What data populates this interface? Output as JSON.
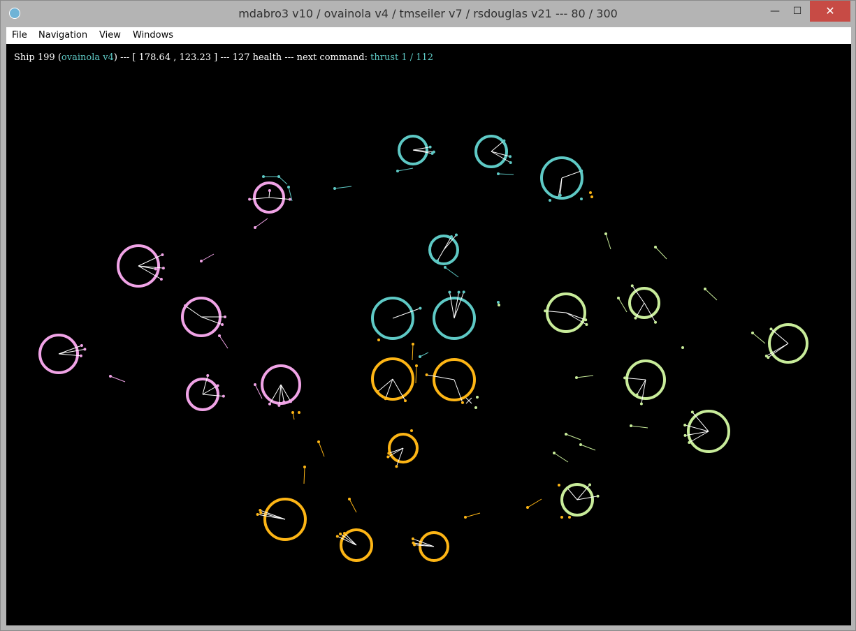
{
  "window": {
    "title": "mdabro3 v10 / ovainola v4 / tmseiler v7 / rsdouglas v21 --- 80 / 300",
    "icon": "gear-icon",
    "controls": {
      "minimize": "—",
      "maximize": "☐",
      "close": "✕"
    }
  },
  "menu": {
    "items": [
      "File",
      "Navigation",
      "View",
      "Windows"
    ]
  },
  "status": {
    "ship_label": "Ship 199",
    "player": "ovainola v4",
    "coords": "[ 178.64 , 123.23 ]",
    "health": "127 health",
    "next_command_label": "next command:",
    "next_command": "thrust 1 / 112",
    "sep": "---"
  },
  "colors": {
    "pink": "#f0a3e6",
    "cyan": "#5ec9c5",
    "orange": "#fdb515",
    "green": "#c8ec9a",
    "white": "#ffffff"
  }
}
